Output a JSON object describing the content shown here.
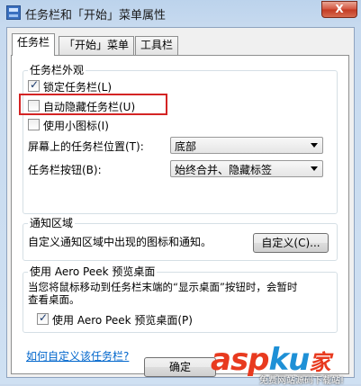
{
  "window": {
    "title": "任务栏和「开始」菜单属性",
    "close_label": "X"
  },
  "tabs": [
    {
      "label": "任务栏",
      "active": true
    },
    {
      "label": "「开始」菜单",
      "active": false
    },
    {
      "label": "工具栏",
      "active": false
    }
  ],
  "appearance": {
    "group_title": "任务栏外观",
    "lock_taskbar": {
      "label": "锁定任务栏(L)",
      "checked": true
    },
    "auto_hide": {
      "label": "自动隐藏任务栏(U)",
      "checked": false
    },
    "small_icons": {
      "label": "使用小图标(I)",
      "checked": false
    },
    "position_label": "屏幕上的任务栏位置(T):",
    "position_value": "底部",
    "buttons_label": "任务栏按钮(B):",
    "buttons_value": "始终合并、隐藏标签"
  },
  "notification": {
    "group_title": "通知区域",
    "description": "自定义通知区域中出现的图标和通知。",
    "customize_button": "自定义(C)..."
  },
  "aero_peek": {
    "group_title": "使用 Aero Peek 预览桌面",
    "description_line1": "当您将鼠标移动到任务栏末端的“显示桌面”按钮时，会暂时",
    "description_line2": "查看桌面。",
    "checkbox": {
      "label": "使用 Aero Peek 预览桌面(P)",
      "checked": true
    }
  },
  "help_link": "如何自定义该任务栏?",
  "footer": {
    "ok_button": "确定"
  },
  "watermark": {
    "brand_a": "asp",
    "brand_b": "ku",
    "brand_c": "家",
    "tagline": "免费网站源码下载站!"
  }
}
